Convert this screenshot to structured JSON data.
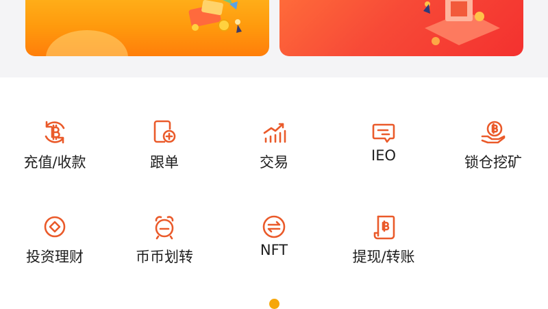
{
  "banners": [
    {
      "title": "",
      "color_from": "#ffb41c",
      "color_to": "#ff7e0a"
    },
    {
      "title": "",
      "color_from": "#ff6d3a",
      "color_to": "#f4312f"
    }
  ],
  "accent_color": "#ea5a2a",
  "menu": [
    {
      "label": "充值/收款",
      "icon": "bitcoin-cycle-icon"
    },
    {
      "label": "跟单",
      "icon": "document-add-icon"
    },
    {
      "label": "交易",
      "icon": "trend-chart-icon"
    },
    {
      "label": "IEO",
      "icon": "chat-bubble-icon"
    },
    {
      "label": "锁仓挖矿",
      "icon": "bitcoin-hand-icon"
    },
    {
      "label": "投资理财",
      "icon": "coin-icon"
    },
    {
      "label": "币币划转",
      "icon": "alarm-clock-icon"
    },
    {
      "label": "NFT",
      "icon": "exchange-icon"
    },
    {
      "label": "提现/转账",
      "icon": "bitcoin-receipt-icon"
    }
  ],
  "pagination": {
    "current": 1,
    "color": "#f6a70b"
  }
}
